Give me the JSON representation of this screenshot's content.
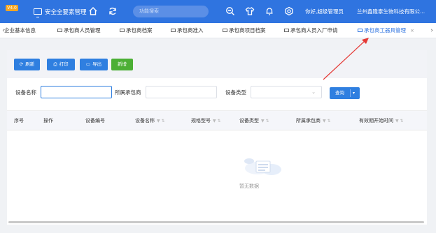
{
  "header": {
    "version_badge": "V4.0",
    "app_title": "安全全要素管理",
    "search_placeholder": "功能搜索",
    "greeting": "你好,超级管理员",
    "company": "兰州鑫隆泰生物科技有限公..."
  },
  "tabs": [
    {
      "label": "企业基本信息"
    },
    {
      "label": "承包商人员管理"
    },
    {
      "label": "承包商档案"
    },
    {
      "label": "承包商准入"
    },
    {
      "label": "承包商项目档案"
    },
    {
      "label": "承包商人员入厂申请"
    },
    {
      "label": "承包商工器具管理",
      "active": true
    }
  ],
  "toolbar": {
    "refresh_label": "刷新",
    "print_label": "打印",
    "export_label": "导出",
    "add_label": "新增"
  },
  "filters": {
    "device_name_label": "设备名称",
    "device_name_value": "",
    "contractor_label": "所属承包商",
    "contractor_value": "",
    "device_type_label": "设备类型",
    "device_type_value": "",
    "query_label": "查询"
  },
  "table": {
    "columns": [
      "序号",
      "操作",
      "设备编号",
      "设备名称",
      "规格型号",
      "设备类型",
      "所属承包商",
      "有效期开始时间"
    ],
    "rows": []
  },
  "empty_text": "暂无数据",
  "colors": {
    "header_bg": "#2f74e0",
    "primary_button": "#2f7fe0",
    "add_button": "#4caf35",
    "annotation_arrow": "#e53935"
  },
  "icons": {
    "monitor": "monitor-icon",
    "home": "home-icon",
    "refresh": "refresh-icon",
    "zoom": "zoom-icon",
    "shirt": "shirt-icon",
    "bell": "bell-icon",
    "settings": "gear-icon"
  }
}
